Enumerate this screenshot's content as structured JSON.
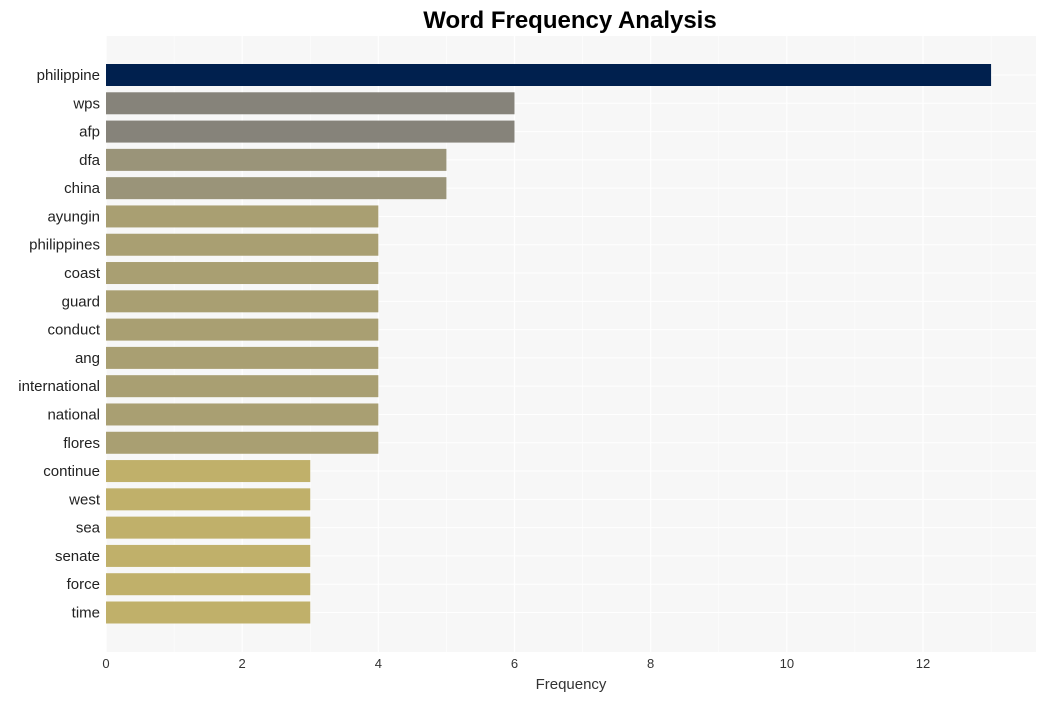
{
  "chart_data": {
    "type": "bar",
    "orientation": "horizontal",
    "title": "Word Frequency Analysis",
    "xlabel": "Frequency",
    "ylabel": "",
    "xlim": [
      0,
      13.65
    ],
    "xticks": [
      0,
      2,
      4,
      6,
      8,
      10,
      12
    ],
    "grid": true,
    "categories": [
      "philippine",
      "wps",
      "afp",
      "dfa",
      "china",
      "ayungin",
      "philippines",
      "coast",
      "guard",
      "conduct",
      "ang",
      "international",
      "national",
      "flores",
      "continue",
      "west",
      "sea",
      "senate",
      "force",
      "time"
    ],
    "values": [
      13,
      6,
      6,
      5,
      5,
      4,
      4,
      4,
      4,
      4,
      4,
      4,
      4,
      4,
      3,
      3,
      3,
      3,
      3,
      3
    ],
    "colors": {
      "13": "#00204e",
      "6": "#86837a",
      "5": "#9a9479",
      "4": "#a99f72",
      "3": "#c0b06a"
    },
    "background": "#f7f7f7"
  }
}
